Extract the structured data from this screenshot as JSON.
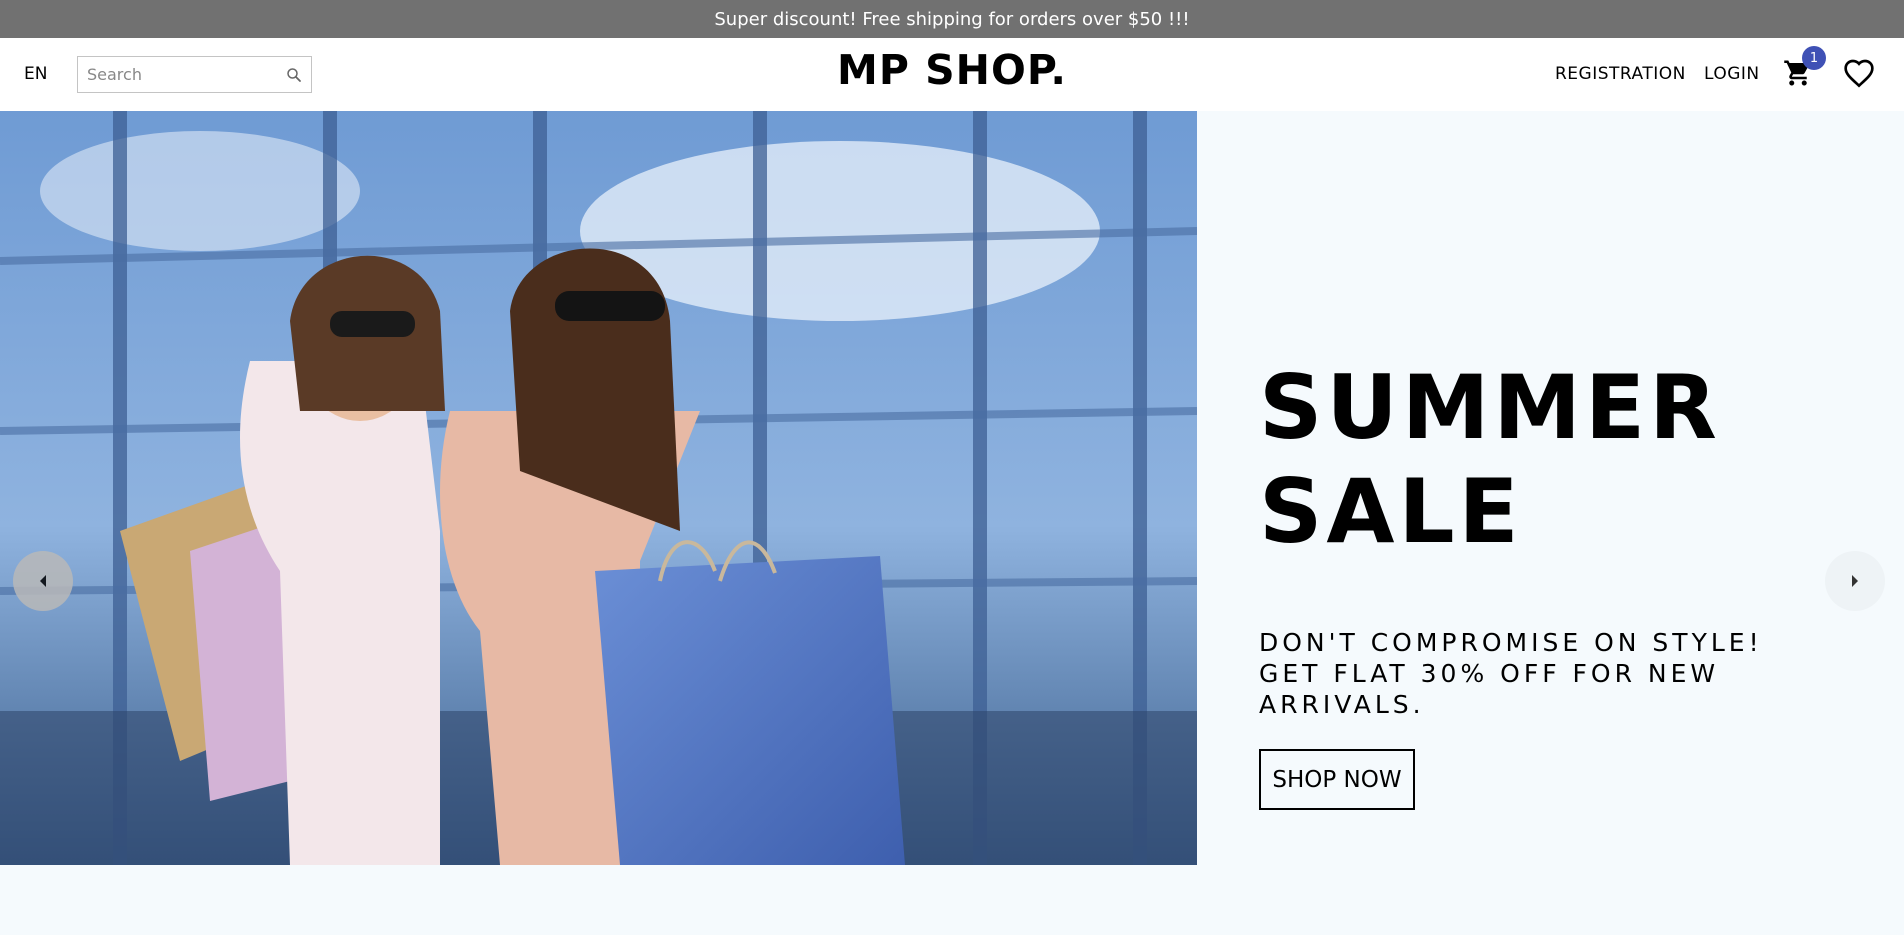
{
  "announcement": {
    "text": "Super discount! Free shipping for orders over $50 !!!"
  },
  "header": {
    "language": "EN",
    "search": {
      "placeholder": "Search",
      "value": ""
    },
    "logo": "MP SHOP.",
    "nav": {
      "registration": "REGISTRATION",
      "login": "LOGIN"
    },
    "cart": {
      "count": "1",
      "icon": "cart-icon"
    },
    "wishlist": {
      "icon": "heart-icon"
    }
  },
  "slider": {
    "title_line1": "SUMMER",
    "title_line2": "SALE",
    "description": "DON'T COMPROMISE ON STYLE! GET FLAT 30% OFF FOR NEW ARRIVALS.",
    "cta": "SHOP NOW",
    "prev_icon": "chevron-left-icon",
    "next_icon": "chevron-right-icon"
  },
  "colors": {
    "announcement_bg": "#717171",
    "page_bg": "#f5fafd",
    "badge_bg": "#3f51b5"
  }
}
